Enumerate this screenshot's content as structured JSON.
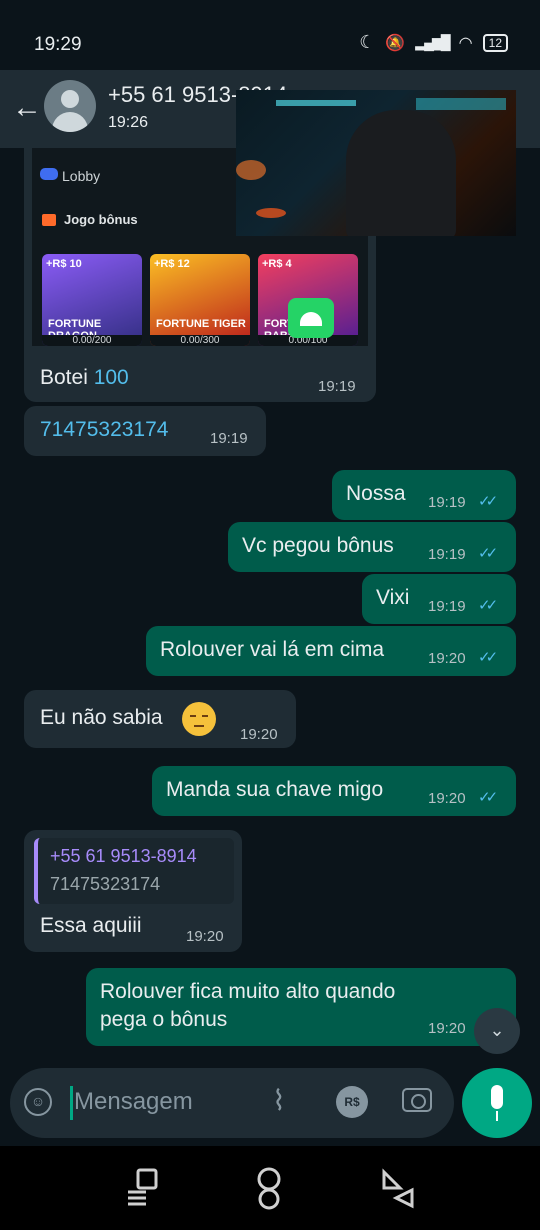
{
  "status_bar": {
    "time": "19:29",
    "battery": "12"
  },
  "header": {
    "contact": "+55 61 9513-8914",
    "status": "19:26"
  },
  "embedded_card": {
    "lobby_label": "Lobby",
    "bonus_title": "Jogo bônus",
    "games": [
      {
        "tag": "+R$ 10",
        "name": "FORTUNE DRAGON",
        "score": "0.00/200",
        "color": "#7c3aed"
      },
      {
        "tag": "+R$ 12",
        "name": "FORTUNE TIGER",
        "score": "0.00/300",
        "color": "#f59e0b"
      },
      {
        "tag": "+R$ 4",
        "name": "FORTUNE RABBIT",
        "score": "0.00/100",
        "color": "#e11d48"
      }
    ],
    "caption_text": "Botei ",
    "caption_number": "100",
    "time": "19:19"
  },
  "messages": [
    {
      "text": "71475323174",
      "time": "19:19"
    },
    {
      "text": "Nossa",
      "time": "19:19"
    },
    {
      "text": "Vc pegou bônus",
      "time": "19:19"
    },
    {
      "text": "Vixi",
      "time": "19:19"
    },
    {
      "text": "Rolouver vai lá em cima",
      "time": "19:20"
    },
    {
      "text": "Eu não sabia",
      "time": "19:20"
    },
    {
      "text": "Manda sua chave migo",
      "time": "19:20"
    },
    {
      "text": "Essa aquiii",
      "time": "19:20"
    },
    {
      "text_line1": "Rolouver fica muito alto quando",
      "text_line2": "pega o bônus",
      "time": "19:20"
    }
  ],
  "quoted": {
    "name": "+55 61 9513-8914",
    "text": "71475323174"
  },
  "composer": {
    "placeholder": "Mensagem",
    "pay_label": "R$"
  },
  "colors": {
    "incoming": "#1f2c34",
    "outgoing": "#005c4b",
    "accent": "#00a884",
    "read_ticks": "#53bdeb"
  }
}
